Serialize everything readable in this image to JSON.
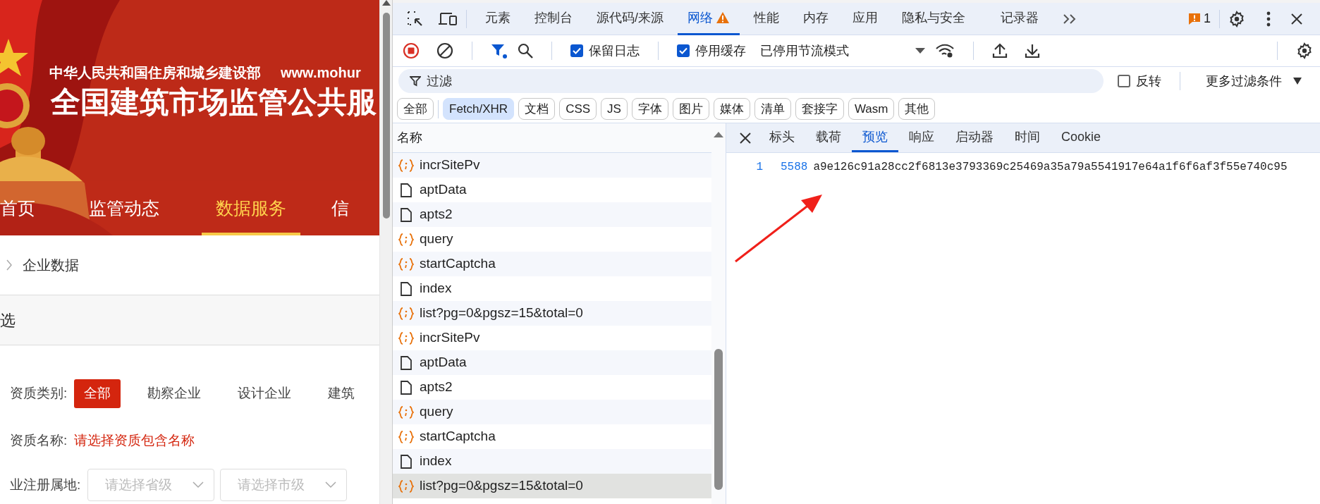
{
  "web_page": {
    "banner": {
      "ministry": "中华人民共和国住房和城乡建设部",
      "url": "www.mohur",
      "title": "全国建筑市场监管公共服"
    },
    "nav": [
      {
        "label": "首页",
        "selected": false
      },
      {
        "label": "监管动态",
        "selected": false
      },
      {
        "label": "数据服务",
        "selected": true
      },
      {
        "label": "信",
        "selected": false
      }
    ],
    "breadcrumb": "企业数据",
    "section_title": "选",
    "filters": [
      {
        "kind": "options",
        "label": "资质类别:",
        "options": [
          {
            "label": "全部",
            "selected": true
          },
          {
            "label": "勘察企业",
            "selected": false
          },
          {
            "label": "设计企业",
            "selected": false
          },
          {
            "label": "建筑",
            "selected": false
          }
        ]
      },
      {
        "kind": "link",
        "label": "资质名称:",
        "value": "请选择资质包含名称"
      },
      {
        "kind": "selects",
        "label": "业注册属地:",
        "selects": [
          {
            "placeholder": "请选择省级"
          },
          {
            "placeholder": "请选择市级"
          }
        ]
      }
    ]
  },
  "devtools": {
    "tabs": [
      {
        "label": "元素",
        "selected": false,
        "warning": false
      },
      {
        "label": "控制台",
        "selected": false,
        "warning": false
      },
      {
        "label": "源代码/来源",
        "selected": false,
        "warning": false
      },
      {
        "label": "网络",
        "selected": true,
        "warning": true
      },
      {
        "label": "性能",
        "selected": false,
        "warning": false
      },
      {
        "label": "内存",
        "selected": false,
        "warning": false
      },
      {
        "label": "应用",
        "selected": false,
        "warning": false
      },
      {
        "label": "隐私与安全",
        "selected": false,
        "warning": false
      },
      {
        "label": "记录器",
        "selected": false,
        "warning": false
      }
    ],
    "issues_count": "1",
    "toolbar": {
      "recording": true,
      "preserve_log": {
        "label": "保留日志",
        "checked": true
      },
      "disable_cache": {
        "label": "停用缓存",
        "checked": true
      },
      "throttling": "已停用节流模式"
    },
    "filter": {
      "placeholder": "过滤",
      "invert": {
        "label": "反转",
        "checked": false
      },
      "more_filters": "更多过滤条件"
    },
    "type_filters": [
      {
        "label": "全部",
        "selected": false
      },
      {
        "label": "Fetch/XHR",
        "selected": true
      },
      {
        "label": "文档",
        "selected": false
      },
      {
        "label": "CSS",
        "selected": false
      },
      {
        "label": "JS",
        "selected": false
      },
      {
        "label": "字体",
        "selected": false
      },
      {
        "label": "图片",
        "selected": false
      },
      {
        "label": "媒体",
        "selected": false
      },
      {
        "label": "清单",
        "selected": false
      },
      {
        "label": "套接字",
        "selected": false
      },
      {
        "label": "Wasm",
        "selected": false
      },
      {
        "label": "其他",
        "selected": false
      }
    ],
    "requests": {
      "column": "名称",
      "rows": [
        {
          "name": "incrSitePv",
          "kind": "fetch",
          "selected": false
        },
        {
          "name": "aptData",
          "kind": "document",
          "selected": false
        },
        {
          "name": "apts2",
          "kind": "document",
          "selected": false
        },
        {
          "name": "query",
          "kind": "fetch",
          "selected": false
        },
        {
          "name": "startCaptcha",
          "kind": "fetch",
          "selected": false
        },
        {
          "name": "index",
          "kind": "document",
          "selected": false
        },
        {
          "name": "list?pg=0&pgsz=15&total=0",
          "kind": "fetch",
          "selected": false
        },
        {
          "name": "incrSitePv",
          "kind": "fetch",
          "selected": false
        },
        {
          "name": "aptData",
          "kind": "document",
          "selected": false
        },
        {
          "name": "apts2",
          "kind": "document",
          "selected": false
        },
        {
          "name": "query",
          "kind": "fetch",
          "selected": false
        },
        {
          "name": "startCaptcha",
          "kind": "fetch",
          "selected": false
        },
        {
          "name": "index",
          "kind": "document",
          "selected": false
        },
        {
          "name": "list?pg=0&pgsz=15&total=0",
          "kind": "fetch",
          "selected": true
        }
      ]
    },
    "detail_tabs": [
      {
        "label": "标头",
        "selected": false
      },
      {
        "label": "载荷",
        "selected": false
      },
      {
        "label": "预览",
        "selected": true
      },
      {
        "label": "响应",
        "selected": false
      },
      {
        "label": "启动器",
        "selected": false
      },
      {
        "label": "时间",
        "selected": false
      },
      {
        "label": "Cookie",
        "selected": false
      }
    ],
    "preview": {
      "line_number": "1",
      "value": "5588",
      "text": "a9e126c91a28cc2f6813e3793369c25469a35a79a5541917e64a1f6f6af3f55e740c95"
    }
  }
}
